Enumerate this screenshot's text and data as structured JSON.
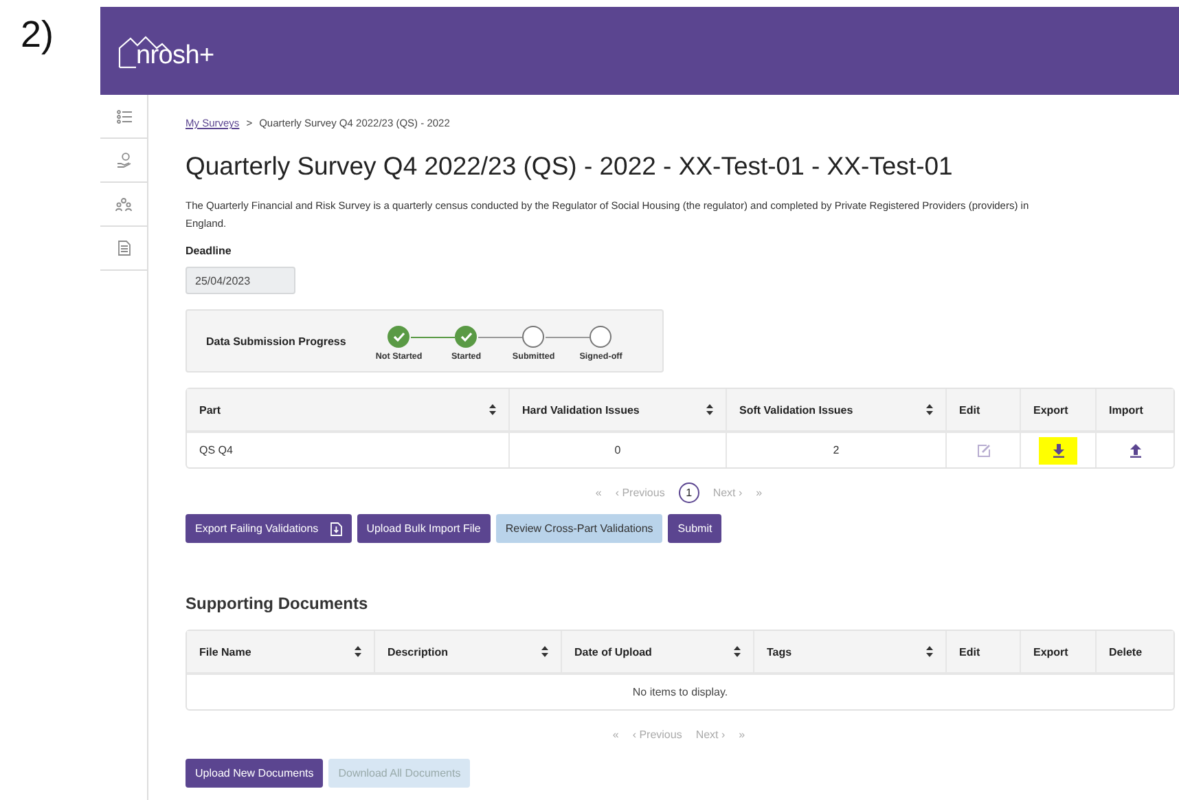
{
  "label": "2)",
  "header": {
    "logo": "nrosh+"
  },
  "breadcrumb": {
    "items": [
      {
        "label": "My Surveys",
        "kind": "link"
      },
      {
        "label": "Quarterly Survey Q4 2022/23 (QS) - 2022",
        "kind": "current"
      }
    ],
    "separator": ">"
  },
  "title": "Quarterly Survey Q4 2022/23 (QS) - 2022 - XX-Test-01 - XX-Test-01",
  "description": "The Quarterly Financial and Risk Survey is a quarterly census conducted by the Regulator of Social Housing (the regulator) and completed by Private Registered Providers (providers) in England.",
  "deadline": {
    "label": "Deadline",
    "value": "25/04/2023"
  },
  "progress": {
    "label": "Data Submission Progress",
    "steps": [
      {
        "label": "Not Started",
        "done": true
      },
      {
        "label": "Started",
        "done": true
      },
      {
        "label": "Submitted",
        "done": false
      },
      {
        "label": "Signed-off",
        "done": false
      }
    ]
  },
  "parts_table": {
    "columns": [
      {
        "label": "Part",
        "sortable": true
      },
      {
        "label": "Hard Validation Issues",
        "sortable": true
      },
      {
        "label": "Soft Validation Issues",
        "sortable": true
      },
      {
        "label": "Edit",
        "sortable": false
      },
      {
        "label": "Export",
        "sortable": false
      },
      {
        "label": "Import",
        "sortable": false
      }
    ],
    "rows": [
      {
        "cells": [
          "QS Q4",
          "0",
          "2"
        ],
        "actions": [
          {
            "kind": "edit",
            "disabled": true,
            "highlighted": false
          },
          {
            "kind": "download",
            "disabled": false,
            "highlighted": true
          },
          {
            "kind": "upload",
            "disabled": false,
            "highlighted": false
          }
        ]
      }
    ]
  },
  "parts_pagination": {
    "first": "«",
    "previous": "‹ Previous",
    "pages": [
      {
        "label": "1",
        "selected": true
      }
    ],
    "next": "Next ›",
    "last": "»"
  },
  "parts_buttons": [
    {
      "label": "Export Failing Validations",
      "disabled": false,
      "has_icon": true
    },
    {
      "label": "Upload Bulk Import File",
      "disabled": false
    },
    {
      "label": "Review Cross-Part Validations",
      "disabled": true
    },
    {
      "label": "Submit",
      "disabled": false
    }
  ],
  "documents": {
    "title": "Supporting Documents",
    "columns": [
      {
        "label": "File Name",
        "sortable": true
      },
      {
        "label": "Description",
        "sortable": true
      },
      {
        "label": "Date of Upload",
        "sortable": true
      },
      {
        "label": "Tags",
        "sortable": true
      },
      {
        "label": "Edit",
        "sortable": false
      },
      {
        "label": "Export",
        "sortable": false
      },
      {
        "label": "Delete",
        "sortable": false
      }
    ],
    "empty_text": "No items to display.",
    "pagination": {
      "first": "«",
      "previous": "‹ Previous",
      "next": "Next ›",
      "last": "»"
    },
    "buttons": [
      {
        "label": "Upload New Documents",
        "disabled": false
      },
      {
        "label": "Download All Documents",
        "disabled": true
      }
    ]
  }
}
